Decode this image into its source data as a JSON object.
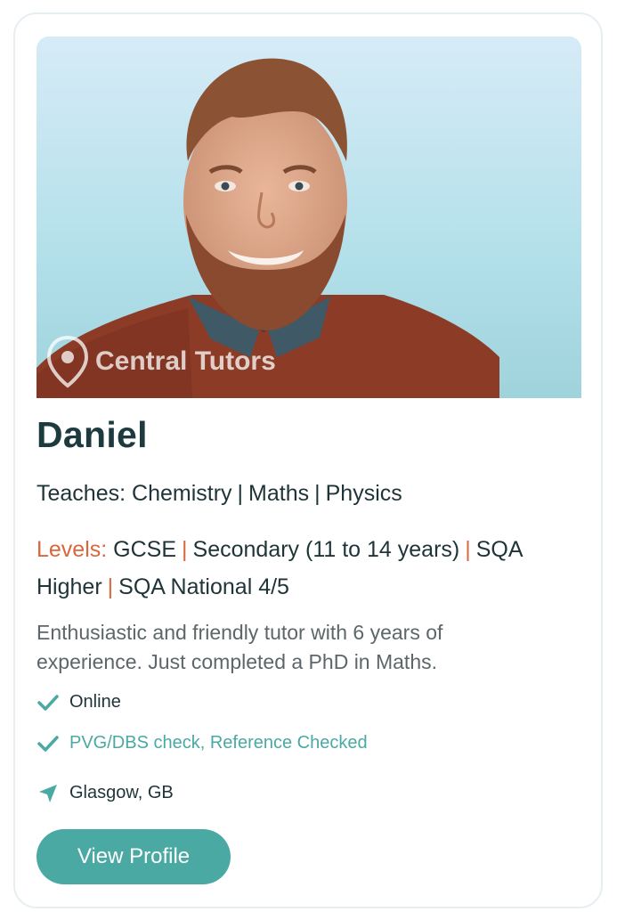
{
  "tutor": {
    "photo_watermark": "Central Tutors",
    "name": "Daniel",
    "teaches_label": "Teaches:",
    "subjects": [
      "Chemistry",
      "Maths",
      "Physics"
    ],
    "levels_label": "Levels:",
    "levels": [
      "GCSE",
      "Secondary (11 to 14 years)",
      "SQA Higher",
      "SQA National 4/5"
    ],
    "level_1": "GCSE",
    "level_2": "Secondary (11 to 14 years)",
    "level_3a": "SQA",
    "level_3b": "Higher",
    "level_4": "SQA National 4/5",
    "description": "Enthusiastic and friendly tutor with 6 years of experience. Just completed a PhD in Maths.",
    "features": {
      "online": "Online",
      "checks": "PVG/DBS check, Reference Checked",
      "location": "Glasgow, GB"
    },
    "icons": {
      "online": "check-icon",
      "checks": "check-icon",
      "location": "navigation-arrow-icon"
    },
    "button_label": "View Profile"
  },
  "colors": {
    "accent": "#4aa9a3",
    "levels_label": "#d9673d",
    "heading": "#1d3a3f",
    "body_text": "#5d6669"
  }
}
